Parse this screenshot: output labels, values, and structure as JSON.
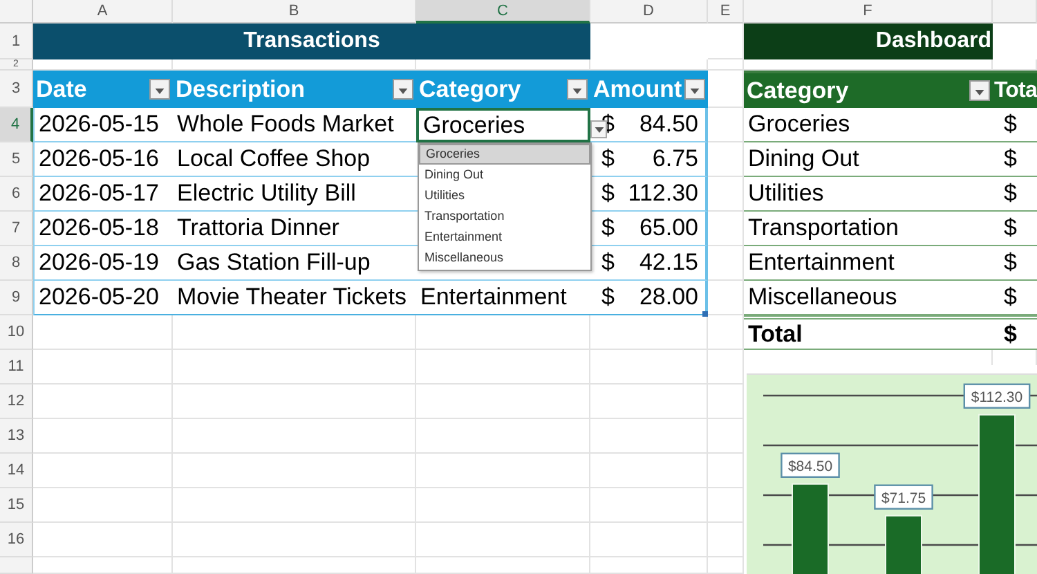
{
  "column_headers": [
    {
      "label": "A",
      "selected": false
    },
    {
      "label": "B",
      "selected": false
    },
    {
      "label": "C",
      "selected": true
    },
    {
      "label": "D",
      "selected": false
    },
    {
      "label": "E",
      "selected": false
    },
    {
      "label": "F",
      "selected": false
    }
  ],
  "row_headers": [
    {
      "label": "1",
      "selected": false
    },
    {
      "label": "2",
      "selected": false
    },
    {
      "label": "3",
      "selected": false
    },
    {
      "label": "4",
      "selected": true
    },
    {
      "label": "5",
      "selected": false
    },
    {
      "label": "6",
      "selected": false
    },
    {
      "label": "7",
      "selected": false
    },
    {
      "label": "8",
      "selected": false
    },
    {
      "label": "9",
      "selected": false
    },
    {
      "label": "10",
      "selected": false
    },
    {
      "label": "11",
      "selected": false
    },
    {
      "label": "12",
      "selected": false
    },
    {
      "label": "13",
      "selected": false
    },
    {
      "label": "14",
      "selected": false
    },
    {
      "label": "15",
      "selected": false
    },
    {
      "label": "16",
      "selected": false
    }
  ],
  "transactions": {
    "title": "Transactions",
    "columns": [
      "Date",
      "Description",
      "Category",
      "Amount"
    ],
    "rows": [
      {
        "date": "2026-05-15",
        "description": "Whole Foods Market",
        "category": "Groceries",
        "selected": true,
        "currency": "$",
        "amount": "84.50"
      },
      {
        "date": "2026-05-16",
        "description": "Local Coffee Shop",
        "selected": false,
        "currency": "$",
        "amount": "6.75"
      },
      {
        "date": "2026-05-17",
        "description": "Electric Utility Bill",
        "selected": false,
        "currency": "$",
        "amount": "112.30"
      },
      {
        "date": "2026-05-18",
        "description": "Trattoria Dinner",
        "selected": false,
        "currency": "$",
        "amount": "65.00"
      },
      {
        "date": "2026-05-19",
        "description": "Gas Station Fill-up",
        "selected": false,
        "currency": "$",
        "amount": "42.15"
      },
      {
        "date": "2026-05-20",
        "description": "Movie Theater Tickets",
        "category": "Entertainment",
        "selected": false,
        "currency": "$",
        "amount": "28.00"
      }
    ]
  },
  "dropdown": {
    "options": [
      {
        "label": "Groceries",
        "selected": true
      },
      {
        "label": "Dining Out",
        "selected": false
      },
      {
        "label": "Utilities",
        "selected": false
      },
      {
        "label": "Transportation",
        "selected": false
      },
      {
        "label": "Entertainment",
        "selected": false
      },
      {
        "label": "Miscellaneous",
        "selected": false
      }
    ]
  },
  "dashboard": {
    "title": "Dashboard",
    "columns": [
      "Category",
      "Tota"
    ],
    "rows": [
      {
        "category": "Groceries",
        "currency": "$"
      },
      {
        "category": "Dining Out",
        "currency": "$"
      },
      {
        "category": "Utilities",
        "currency": "$"
      },
      {
        "category": "Transportation",
        "currency": "$"
      },
      {
        "category": "Entertainment",
        "currency": "$"
      },
      {
        "category": "Miscellaneous",
        "currency": "$"
      }
    ],
    "total": {
      "label": "Total",
      "currency": "$"
    }
  },
  "chart": {
    "bar_labels": [
      "$84.50",
      "$71.75",
      "$112.30"
    ]
  }
}
